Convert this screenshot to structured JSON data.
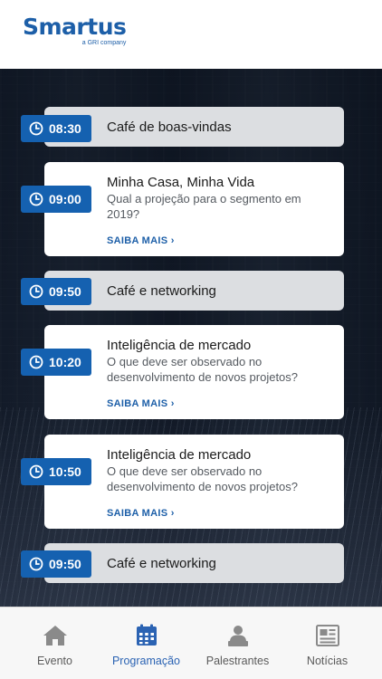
{
  "brand": {
    "name": "Smartus",
    "tagline": "a GRI company",
    "color": "#1d5fa8"
  },
  "schedule": [
    {
      "time": "08:30",
      "title": "Café de boas-vindas",
      "type": "simple"
    },
    {
      "time": "09:00",
      "title": "Minha Casa, Minha Vida",
      "description": "Qual a projeção para o segmento em 2019?",
      "link": "SAIBA MAIS ›",
      "type": "detail"
    },
    {
      "time": "09:50",
      "title": "Café e networking",
      "type": "simple"
    },
    {
      "time": "10:20",
      "title": "Inteligência de mercado",
      "description": "O que deve ser observado no desenvolvimento de novos projetos?",
      "link": "SAIBA MAIS ›",
      "type": "detail"
    },
    {
      "time": "10:50",
      "title": "Inteligência de mercado",
      "description": "O que deve ser observado no desenvolvimento de novos projetos?",
      "link": "SAIBA MAIS ›",
      "type": "detail"
    },
    {
      "time": "09:50",
      "title": "Café e networking",
      "type": "simple"
    }
  ],
  "tabs": [
    {
      "label": "Evento",
      "icon": "home-icon",
      "active": false
    },
    {
      "label": "Programação",
      "icon": "calendar-icon",
      "active": true
    },
    {
      "label": "Palestrantes",
      "icon": "speaker-icon",
      "active": false
    },
    {
      "label": "Notícias",
      "icon": "newspaper-icon",
      "active": false
    }
  ],
  "colors": {
    "accent": "#1561b0",
    "active_tab": "#2b63b3",
    "inactive_tab": "#5a5a5a"
  }
}
